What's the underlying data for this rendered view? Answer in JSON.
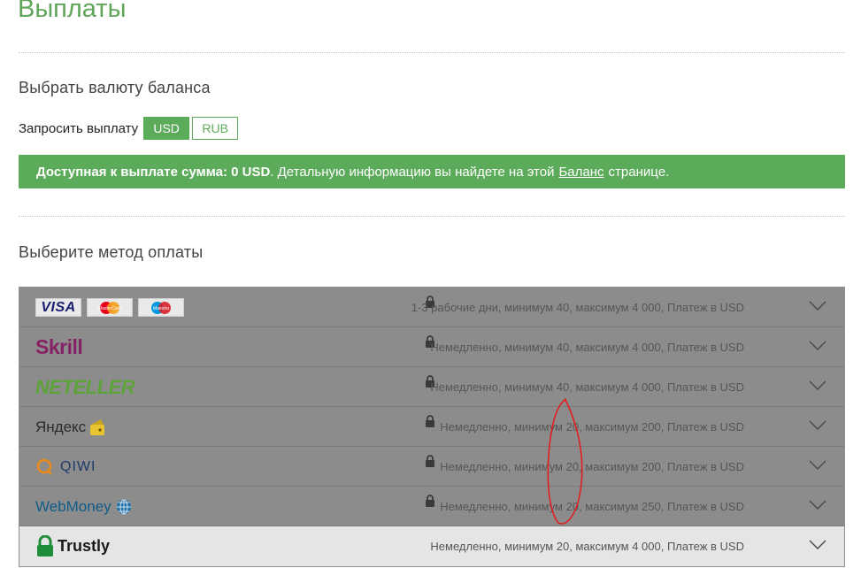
{
  "page": {
    "title": "Выплаты",
    "currency_section_title": "Выбрать валюту баланса",
    "request_label": "Запросить выплату",
    "currencies": [
      {
        "label": "USD",
        "active": true
      },
      {
        "label": "RUB",
        "active": false
      }
    ],
    "banner": {
      "prefix": "Доступная к выплате сумма:",
      "amount": "0 USD",
      "middle": ". Детальную информацию вы найдете на этой",
      "link": "Баланс",
      "suffix": "страницe."
    },
    "methods_title": "Выберите метод оплаты"
  },
  "methods": [
    {
      "name": "Visa / MasterCard / Maestro",
      "logo_text": "VISA",
      "logo_text_2": "MasterCard",
      "logo_text_3": "Maestro",
      "info": "1-3 рабочие дни, минимум 40, максимум 4 000, Платеж в USD",
      "locked": true
    },
    {
      "name": "Skrill",
      "logo_text": "Skrill",
      "info": "Немедленно, минимум 40, максимум 4 000, Платеж в USD",
      "locked": true
    },
    {
      "name": "Neteller",
      "logo_text": "NETELLER",
      "info": "Немедленно, минимум 40, максимум 4 000, Платеж в USD",
      "locked": true
    },
    {
      "name": "Yandex",
      "logo_text": "Яндекс",
      "info": "Немедленно, минимум 20, максимум 200, Платеж в USD",
      "locked": true
    },
    {
      "name": "QIWI",
      "logo_text": "QIWI",
      "info": "Немедленно, минимум 20, максимум 200, Платеж в USD",
      "locked": true
    },
    {
      "name": "WebMoney",
      "logo_text": "WebMoney",
      "info": "Немедленно, минимум 20, максимум 250, Платеж в USD",
      "locked": true
    },
    {
      "name": "Trustly",
      "logo_text": "Trustly",
      "info": "Немедленно, минимум 20, максимум 4 000, Платеж в USD",
      "locked": false
    }
  ],
  "colors": {
    "accent": "#5cab5a",
    "locked_row": "#8c8c8c",
    "open_row": "#e5e5e5",
    "annotation": "#e02020"
  }
}
